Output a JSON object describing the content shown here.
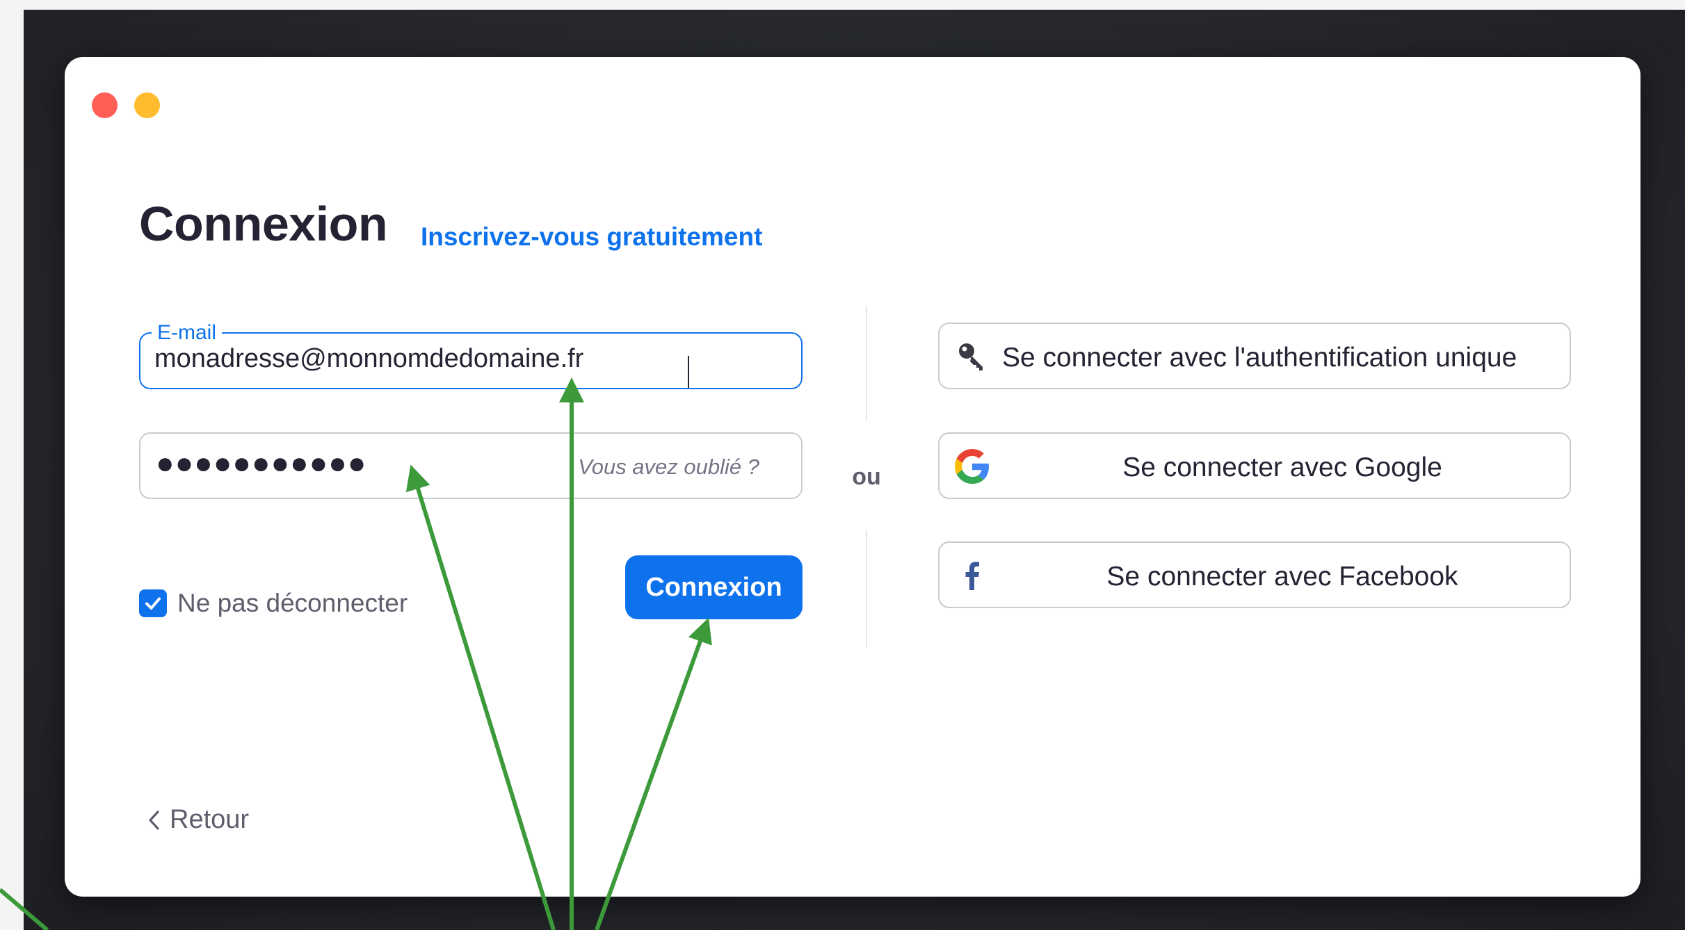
{
  "window": {
    "traffic_lights": [
      {
        "name": "close",
        "color": "#ff5f57"
      },
      {
        "name": "minimize",
        "color": "#febc2e"
      }
    ]
  },
  "login": {
    "title": "Connexion",
    "signup_link": "Inscrivez-vous gratuitement",
    "email_label": "E-mail",
    "email_value": "monadresse@monnomdedomaine.fr",
    "password_mask": "●●●●●●●●●●●",
    "forgot_link": "Vous avez oublié ?",
    "remember_label": "Ne pas déconnecter",
    "remember_checked": true,
    "submit_label": "Connexion",
    "back_label": "Retour"
  },
  "divider": {
    "or_label": "ou"
  },
  "social": {
    "sso_label": "Se connecter avec l'authentification unique",
    "google_label": "Se connecter avec Google",
    "facebook_label": "Se connecter avec Facebook",
    "sso_icon": "key-icon",
    "google_icon": "google-icon",
    "facebook_icon": "facebook-icon"
  },
  "colors": {
    "accent": "#0e72ed",
    "link": "#0e72ed",
    "annotation_arrow": "#3d9a3a",
    "text_primary": "#232333",
    "text_secondary": "#5d5e6b"
  }
}
